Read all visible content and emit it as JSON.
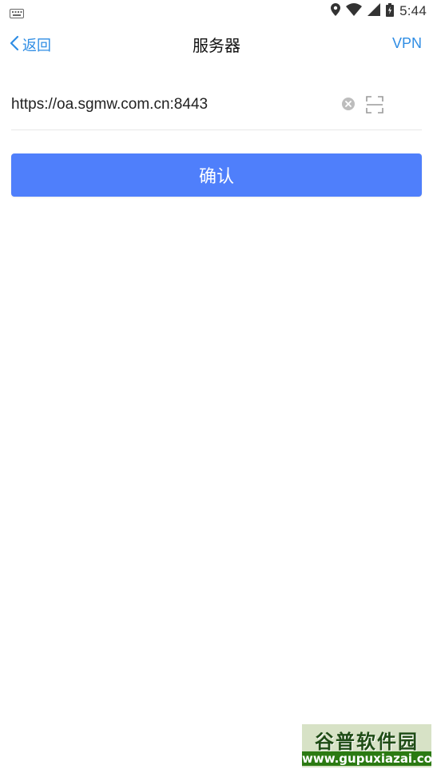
{
  "status_bar": {
    "time": "5:44",
    "icons": [
      "keyboard-icon",
      "location-icon",
      "wifi-icon",
      "signal-icon",
      "battery-charging-icon"
    ]
  },
  "nav": {
    "back_label": "返回",
    "title": "服务器",
    "right_label": "VPN"
  },
  "server": {
    "value": "https://oa.sgmw.com.cn:8443",
    "placeholder": ""
  },
  "confirm": {
    "label": "确认"
  },
  "watermark": {
    "title": "谷普软件园",
    "url": "www.gupuxiazai.com"
  },
  "colors": {
    "accent": "#2f8de4",
    "button": "#4f7ffb"
  }
}
